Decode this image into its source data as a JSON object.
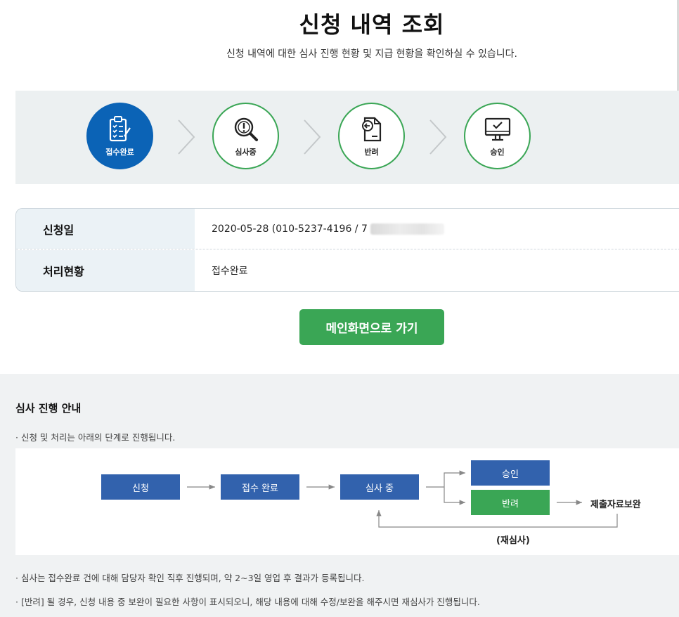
{
  "page": {
    "title": "신청 내역 조회",
    "subtitle": "신청 내역에 대한 심사 진행 현황 및 지급 현황을 확인하실 수 있습니다."
  },
  "steps": [
    {
      "label": "접수완료",
      "icon": "clipboard-check-icon",
      "active": true
    },
    {
      "label": "심사중",
      "icon": "magnifier-alert-icon",
      "active": false
    },
    {
      "label": "반려",
      "icon": "document-return-icon",
      "active": false
    },
    {
      "label": "승인",
      "icon": "monitor-check-icon",
      "active": false
    }
  ],
  "info": {
    "apply_date_label": "신청일",
    "apply_date_value": "2020-05-28  (010-5237-4196 / 7",
    "status_label": "처리현황",
    "status_value": "접수완료"
  },
  "main_button": "메인화면으로 가기",
  "guide": {
    "title": "심사 진행 안내",
    "note1": "·  신청 및 처리는 아래의 단계로 진행됩니다.",
    "flow": {
      "apply": "신청",
      "received": "접수 완료",
      "review": "심사 중",
      "approve": "승인",
      "reject": "반려",
      "supplement": "제출자료보완",
      "rereview": "(재심사)"
    },
    "note2": "·  심사는 접수완료 건에 대해 담당자 확인 직후 진행되며, 약 2~3일 영업 후 결과가 등록됩니다.",
    "note3": "·  [반려] 될 경우, 신청 내용 중 보완이 필요한 사항이 표시되오니, 해당 내용에 대해 수정/보완을 해주시면 재심사가 진행됩니다."
  },
  "colors": {
    "blue": "#0b63b6",
    "green": "#3aa655",
    "flow_blue": "#3262ad"
  }
}
